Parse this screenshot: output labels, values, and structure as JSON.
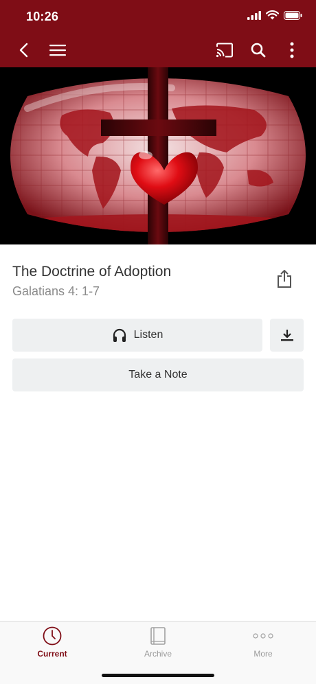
{
  "status_bar": {
    "time": "10:26"
  },
  "nav": {
    "back_icon": "chevron-left-icon",
    "menu_icon": "hamburger-menu-icon",
    "cast_icon": "cast-icon",
    "search_icon": "search-icon",
    "more_icon": "vertical-ellipsis-icon"
  },
  "colors": {
    "brand": "#7f0d16",
    "button_bg": "#eef0f1",
    "subtitle": "#8a8a8a"
  },
  "sermon": {
    "title": "The Doctrine of Adoption",
    "reference": "Galatians 4: 1-7"
  },
  "actions": {
    "listen_label": "Listen",
    "note_label": "Take a Note"
  },
  "tabs": [
    {
      "label": "Current",
      "icon": "clock-icon",
      "active": true
    },
    {
      "label": "Archive",
      "icon": "book-icon",
      "active": false
    },
    {
      "label": "More",
      "icon": "more-dots-icon",
      "active": false
    }
  ]
}
